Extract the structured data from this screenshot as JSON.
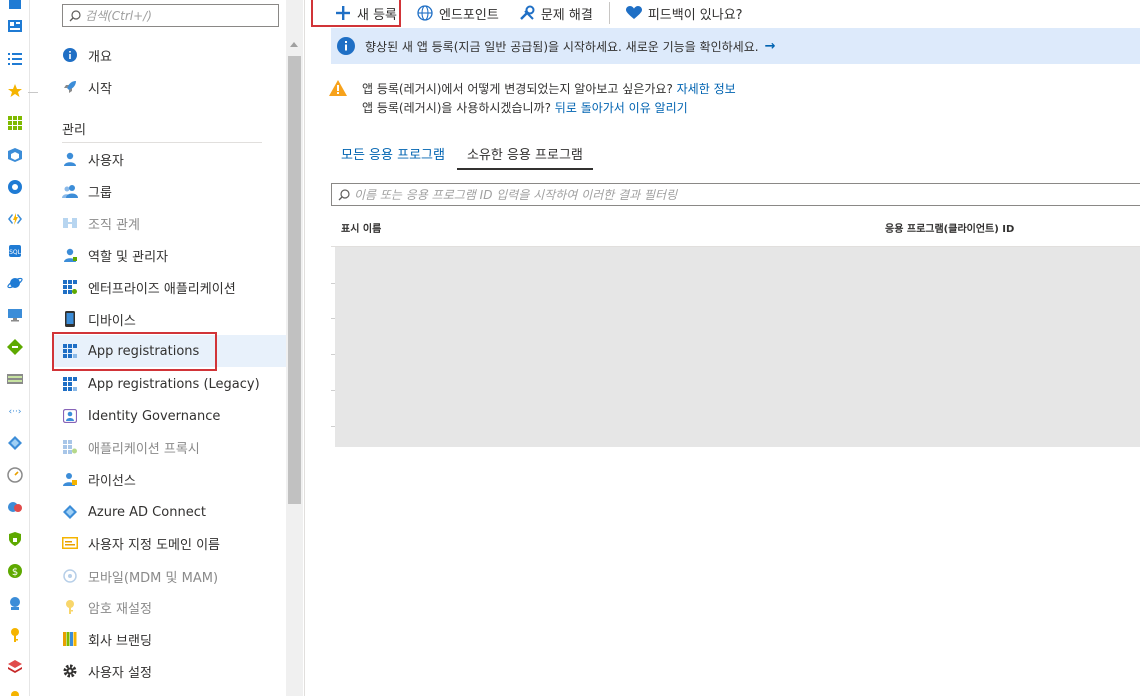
{
  "menu": {
    "search_placeholder": "검색(Ctrl+/)",
    "collapse": "«",
    "section_manage": "관리",
    "items": [
      {
        "label": "개요"
      },
      {
        "label": "시작"
      },
      {
        "label": "사용자"
      },
      {
        "label": "그룹"
      },
      {
        "label": "조직 관계"
      },
      {
        "label": "역할 및 관리자"
      },
      {
        "label": "엔터프라이즈 애플리케이션"
      },
      {
        "label": "디바이스"
      },
      {
        "label": "App registrations"
      },
      {
        "label": "App registrations (Legacy)"
      },
      {
        "label": "Identity Governance"
      },
      {
        "label": "애플리케이션 프록시"
      },
      {
        "label": "라이선스"
      },
      {
        "label": "Azure AD Connect"
      },
      {
        "label": "사용자 지정 도메인 이름"
      },
      {
        "label": "모바일(MDM 및 MAM)"
      },
      {
        "label": "암호 재설정"
      },
      {
        "label": "회사 브랜딩"
      },
      {
        "label": "사용자 설정"
      }
    ]
  },
  "toolbar": {
    "new_registration": "새 등록",
    "endpoints": "엔드포인트",
    "troubleshoot": "문제 해결",
    "feedback": "피드백이 있나요?"
  },
  "banner": {
    "text": "향상된 새 앱 등록(지금 일반 공급됨)을 시작하세요. 새로운 기능을 확인하세요.",
    "arrow": "→"
  },
  "warning": {
    "line1": "앱 등록(레거시)에서 어떻게 변경되었는지 알아보고 싶은가요?",
    "line1_link": "자세한 정보",
    "line2": "앱 등록(레거시)을 사용하시겠습니까?",
    "line2_link": "뒤로 돌아가서 이유 알리기"
  },
  "tabs": {
    "all": "모든 응용 프로그램",
    "owned": "소유한 응용 프로그램"
  },
  "filter": {
    "placeholder": "이름 또는 응용 프로그램 ID 입력을 시작하여 이러한 결과 필터링"
  },
  "table": {
    "col_display_name": "표시 이름",
    "col_app_id": "응용 프로그램(클라이언트) ID"
  },
  "colors": {
    "accent": "#0063b1",
    "highlight_box": "#d13438",
    "banner_bg": "#ddeafb",
    "selected_bg": "#e8f1fb"
  }
}
